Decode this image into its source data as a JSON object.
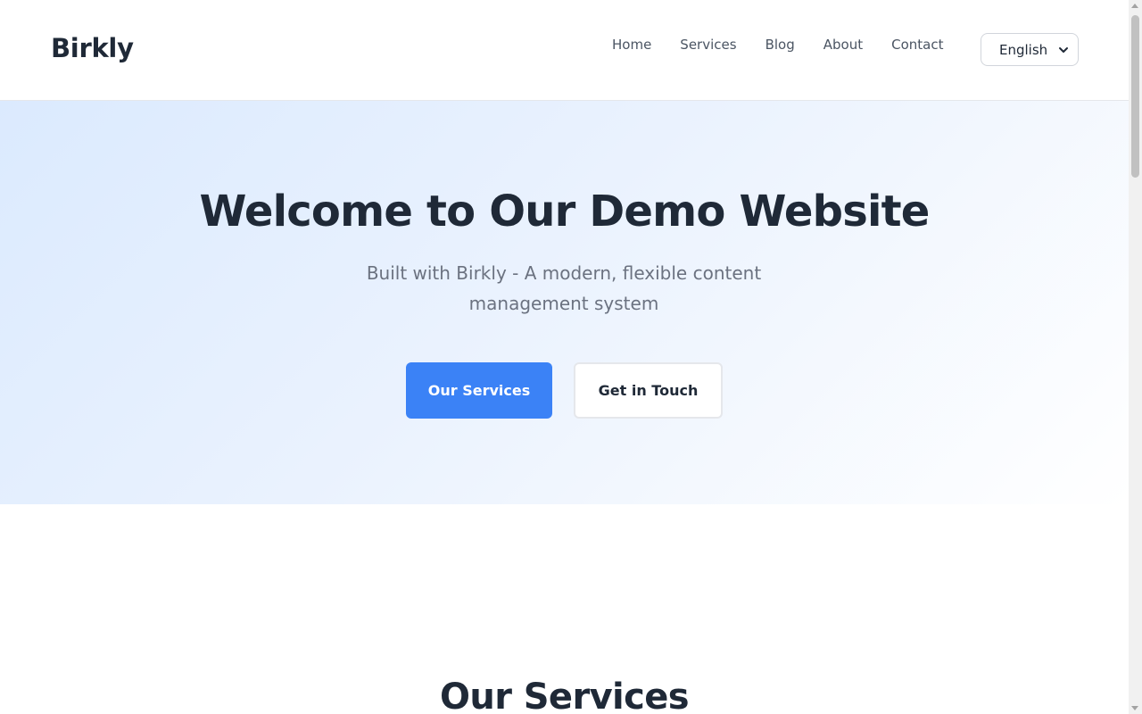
{
  "header": {
    "logo": "Birkly",
    "nav": [
      "Home",
      "Services",
      "Blog",
      "About",
      "Contact"
    ],
    "language": {
      "selected": "English"
    }
  },
  "hero": {
    "title": "Welcome to Our Demo Website",
    "subtitle": "Built with Birkly - A modern, flexible content management system",
    "primary_button": "Our Services",
    "secondary_button": "Get in Touch"
  },
  "services": {
    "title": "Our Services"
  },
  "colors": {
    "accent": "#3b82f6",
    "text": "#1f2937",
    "muted": "#6b7280"
  },
  "icons": {
    "language_dropdown": "chevron-down-icon"
  }
}
